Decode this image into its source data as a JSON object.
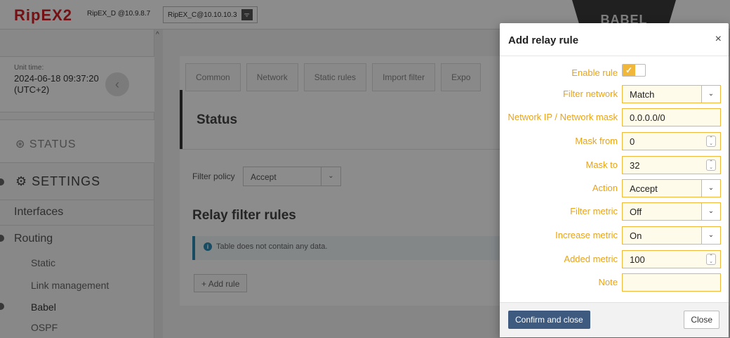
{
  "topbar": {
    "logo": "RipEX2",
    "device_a": "RipEX_D @10.9.8.7",
    "device_b": "RipEX_C@10.10.10.3",
    "device_b_icon": "antenna-icon",
    "banner": "BABEL"
  },
  "sidebar": {
    "unit_time_label": "Unit time:",
    "unit_time_value": "2024-06-18 09:37:20 (UTC+2)",
    "status": "STATUS",
    "settings": "SETTINGS",
    "items": [
      "Interfaces",
      "Routing"
    ],
    "sub_items": [
      "Static",
      "Link management",
      "Babel",
      "OSPF"
    ]
  },
  "main": {
    "tabs": [
      "Common",
      "Network",
      "Static rules",
      "Import filter",
      "Expo"
    ],
    "status_title": "Status",
    "filter_policy_label": "Filter policy",
    "filter_policy_value": "Accept",
    "relay_title": "Relay filter rules",
    "info_text": "Table does not contain any data.",
    "add_rule": "Add rule"
  },
  "modal": {
    "title": "Add relay rule",
    "close_x": "×",
    "fields": {
      "enable_rule_label": "Enable rule",
      "enable_rule_checked": true,
      "filter_network_label": "Filter network",
      "filter_network_value": "Match",
      "network_ip_label": "Network IP / Network mask",
      "network_ip_value": "0.0.0.0/0",
      "mask_from_label": "Mask from",
      "mask_from_value": "0",
      "mask_to_label": "Mask to",
      "mask_to_value": "32",
      "action_label": "Action",
      "action_value": "Accept",
      "filter_metric_label": "Filter metric",
      "filter_metric_value": "Off",
      "increase_metric_label": "Increase metric",
      "increase_metric_value": "On",
      "added_metric_label": "Added metric",
      "added_metric_value": "100",
      "note_label": "Note",
      "note_value": ""
    },
    "confirm_label": "Confirm and close",
    "close_label": "Close"
  },
  "colors": {
    "accent_label": "#e8a317",
    "field_border": "#f0b73a",
    "confirm_button": "#3e5a7e",
    "logo_red": "#d41f26"
  }
}
